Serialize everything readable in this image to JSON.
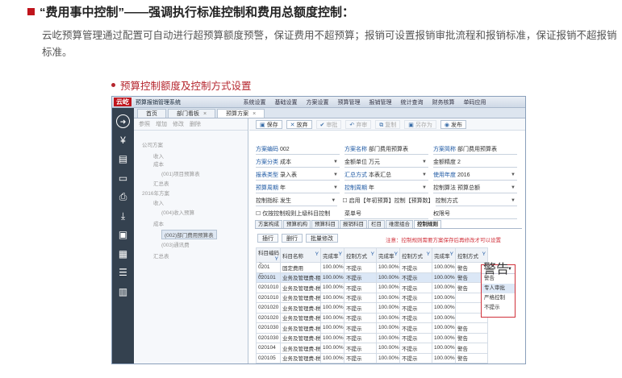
{
  "page": {
    "heading": "“费用事中控制”——强调执行标准控制和费用总额度控制：",
    "paragraph": "云屹预算管理通过配置可自动进行超预算额度预警，保证费用不超预算；报销可设置报销审批流程和报销标准，保证报销不超报销标准。",
    "subheading": "预算控制额度及控制方式设置",
    "accent_color": "#c0141c"
  },
  "app": {
    "logo": "云屹",
    "title": "预算报销管理系统",
    "menus": [
      "系统设置",
      "基础设置",
      "方案设置",
      "预算管理",
      "报销管理",
      "统计查询",
      "财务核算",
      "单码应用"
    ]
  },
  "sidebar": {
    "icons": [
      "arrow-right-icon",
      "money-icon",
      "document-icon",
      "card-icon",
      "printer-icon",
      "download-icon",
      "briefcase-icon",
      "calendar-icon",
      "list-icon",
      "calculator-icon"
    ]
  },
  "tabs": [
    {
      "label": "首页"
    },
    {
      "label": "部门看板",
      "close": "×"
    },
    {
      "label": "预算方案",
      "close": "×"
    }
  ],
  "left_toolbar": [
    "参照",
    "增加",
    "修改",
    "删除"
  ],
  "tree": [
    {
      "label": "公司方案"
    },
    {
      "label": "收入"
    },
    {
      "label": "成本"
    },
    {
      "label": "(001)项目预算表"
    },
    {
      "label": "汇总表"
    },
    {
      "label": "2016年方案"
    },
    {
      "label": "收入"
    },
    {
      "label": "(004)收入预算"
    },
    {
      "label": "成本"
    },
    {
      "label": "(002)部门费用预算表"
    },
    {
      "label": "(003)通讯费"
    },
    {
      "label": "汇总表"
    }
  ],
  "right_toolbar": [
    {
      "label": "保存",
      "icon": "save-icon",
      "enabled": true
    },
    {
      "label": "放弃",
      "icon": "close-icon",
      "enabled": true
    },
    {
      "label": "审批",
      "icon": "check-icon",
      "enabled": false
    },
    {
      "label": "弃审",
      "icon": "undo-icon",
      "enabled": false
    },
    {
      "label": "复制",
      "icon": "copy-icon",
      "enabled": false
    },
    {
      "label": "另存为",
      "icon": "save-as-icon",
      "enabled": false
    },
    {
      "label": "发布",
      "icon": "publish-icon",
      "enabled": true
    }
  ],
  "form": {
    "rows": [
      [
        {
          "label": "方案编码",
          "value": "002",
          "blue": true
        },
        {
          "label": "方案名称",
          "value": "部门费用预算表",
          "blue": true
        },
        {
          "label": "方案简称",
          "value": "部门费用预算表",
          "blue": true
        }
      ],
      [
        {
          "label": "方案分类",
          "value": "成本",
          "blue": true,
          "dd": true
        },
        {
          "label": "金额单位",
          "value": "万元",
          "blue": false,
          "dd": true
        },
        {
          "label": "金额精度",
          "value": "2",
          "blue": false,
          "dd": false
        }
      ],
      [
        {
          "label": "报表类型",
          "value": "录入表",
          "blue": true,
          "dd": true
        },
        {
          "label": "汇总方式",
          "value": "本表汇总",
          "blue": true,
          "dd": true
        },
        {
          "label": "使用年度",
          "value": "2016",
          "blue": true,
          "dd": true
        }
      ],
      [
        {
          "label": "预算周期",
          "value": "年",
          "blue": true,
          "dd": true
        },
        {
          "label": "控制周期",
          "value": "年",
          "blue": true,
          "dd": true
        },
        {
          "label": "控制算法",
          "value": "预算总额",
          "blue": false,
          "dd": true
        }
      ],
      [
        {
          "label": "控制指标",
          "value": "发生",
          "blue": false,
          "dd": true
        },
        {
          "label": "启用【年初预算】控制【预算数】",
          "value": "",
          "blue": false,
          "dd": false,
          "checkbox": true
        },
        {
          "label": "控制方式",
          "value": "",
          "blue": false,
          "dd": true
        }
      ],
      [
        {
          "label": "仅按控制规则上级科目控制",
          "value": "",
          "blue": false,
          "dd": false,
          "checkbox": true
        },
        {
          "label": "菜单号",
          "value": "",
          "blue": false,
          "dd": false
        },
        {
          "label": "权限号",
          "value": "",
          "blue": false,
          "dd": false
        }
      ]
    ]
  },
  "subtabs": [
    "方案构成",
    "预算机构",
    "预算科目",
    "报销科目",
    "栏目",
    "维度组合",
    "控制规则"
  ],
  "grid_toolbar": [
    "插行",
    "删行",
    "批量修改"
  ],
  "notice": "注意：控制规则需要方案保存后再修改才可以设置",
  "grid": {
    "headers": [
      "科目编码",
      "科目名称",
      "完成率",
      "控制方式",
      "完成率",
      "控制方式",
      "完成率",
      "控制方式"
    ],
    "filter_icon": "Y",
    "rows": [
      [
        "0201",
        "固定费用",
        "100.00%",
        "不提示",
        "100.00%",
        "不提示",
        "100.00%",
        "警告"
      ],
      [
        "020101",
        "业务及管理费-租金",
        "100.00%",
        "不提示",
        "100.00%",
        "不提示",
        "100.00%",
        "警告"
      ],
      [
        "0201010",
        "业务及管理费-税",
        "100.00%",
        "不提示",
        "100.00%",
        "不提示",
        "100.00%",
        "警告"
      ],
      [
        "0201010",
        "业务及管理费-税",
        "100.00%",
        "不提示",
        "100.00%",
        "不提示",
        "100.00%",
        ""
      ],
      [
        "0201020",
        "业务及管理费-税",
        "100.00%",
        "不提示",
        "100.00%",
        "不提示",
        "100.00%",
        ""
      ],
      [
        "0201020",
        "业务及管理费-税",
        "100.00%",
        "不提示",
        "100.00%",
        "不提示",
        "100.00%",
        ""
      ],
      [
        "0201030",
        "业务及管理费-税",
        "100.00%",
        "不提示",
        "100.00%",
        "不提示",
        "100.00%",
        "警告"
      ],
      [
        "0201030",
        "业务及管理费-税",
        "100.00%",
        "不提示",
        "100.00%",
        "不提示",
        "100.00%",
        "警告"
      ],
      [
        "020104",
        "业务及管理费-税",
        "100.00%",
        "不提示",
        "100.00%",
        "不提示",
        "100.00%",
        "警告"
      ],
      [
        "020105",
        "业务及管理费-税",
        "100.00%",
        "不提示",
        "100.00%",
        "不提示",
        "100.00%",
        "警告"
      ]
    ],
    "row_marks": [
      ">",
      "⊏"
    ]
  },
  "dropdown": {
    "current": "警告",
    "options": [
      "警告",
      "专人审批",
      "严格控制",
      "不提示"
    ]
  }
}
